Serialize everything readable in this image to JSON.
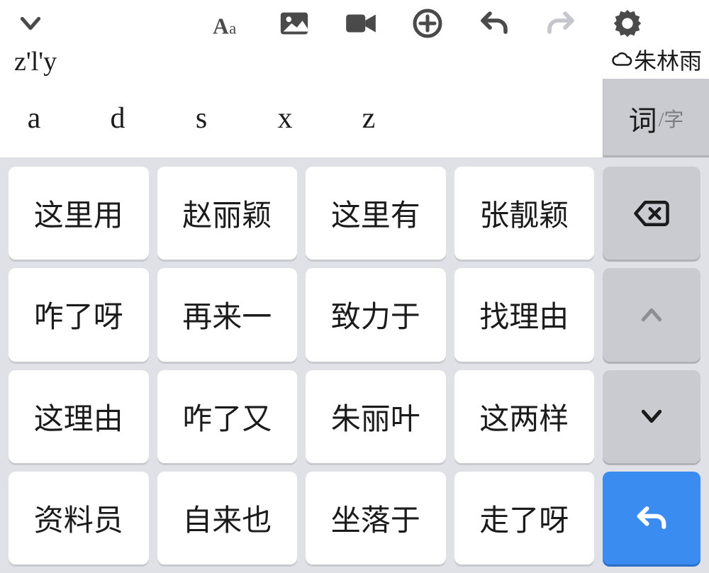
{
  "toolbar": {
    "icons": [
      "chevron-down",
      "text-format",
      "image",
      "video",
      "add",
      "undo",
      "redo",
      "settings"
    ]
  },
  "pinyin": "z'l'y",
  "cloud_name": "朱林雨",
  "filter_letters": [
    "a",
    "d",
    "s",
    "x",
    "z"
  ],
  "mode": {
    "primary": "词",
    "secondary": "/字"
  },
  "candidates": [
    "这里用",
    "赵丽颖",
    "这里有",
    "张靓颖",
    "咋了呀",
    "再来一",
    "致力于",
    "找理由",
    "这理由",
    "咋了又",
    "朱丽叶",
    "这两样",
    "资料员",
    "自来也",
    "坐落于",
    "走了呀"
  ],
  "side_keys": [
    "backspace",
    "page-up",
    "page-down",
    "enter"
  ]
}
